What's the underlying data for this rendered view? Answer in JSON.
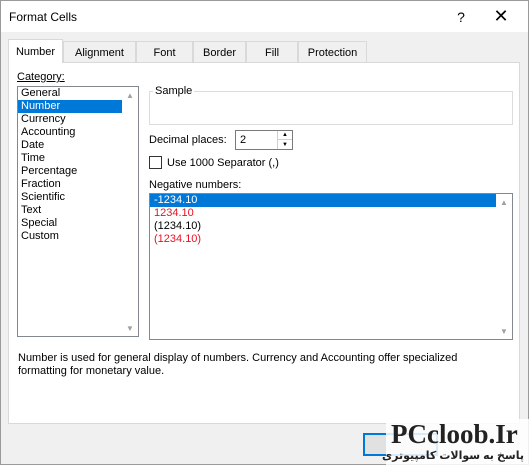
{
  "window": {
    "title": "Format Cells",
    "help_label": "?",
    "close_label": "✕"
  },
  "tabs": [
    {
      "label": "Number",
      "active": true
    },
    {
      "label": "Alignment",
      "active": false
    },
    {
      "label": "Font",
      "active": false
    },
    {
      "label": "Border",
      "active": false
    },
    {
      "label": "Fill",
      "active": false
    },
    {
      "label": "Protection",
      "active": false
    }
  ],
  "category": {
    "label": "Category:",
    "items": [
      "General",
      "Number",
      "Currency",
      "Accounting",
      "Date",
      "Time",
      "Percentage",
      "Fraction",
      "Scientific",
      "Text",
      "Special",
      "Custom"
    ],
    "selected": "Number"
  },
  "sample": {
    "label": "Sample",
    "value": ""
  },
  "decimal_places": {
    "label": "Decimal places:",
    "value": "2"
  },
  "separator": {
    "label": "Use 1000 Separator (,)",
    "checked": false
  },
  "negative_numbers": {
    "label": "Negative numbers:",
    "items": [
      {
        "text": "-1234.10",
        "red": false,
        "selected": true
      },
      {
        "text": "1234.10",
        "red": true,
        "selected": false
      },
      {
        "text": "(1234.10)",
        "red": false,
        "selected": false
      },
      {
        "text": "(1234.10)",
        "red": true,
        "selected": false
      }
    ]
  },
  "description": "Number is used for general display of numbers.  Currency and Accounting offer specialized formatting for monetary value.",
  "watermark": {
    "logo": "PCcloob.Ir",
    "subtitle": "پاسخ به سوالات کامپیوتری"
  },
  "colors": {
    "selection": "#0078d7",
    "negative_red": "#e81123"
  }
}
